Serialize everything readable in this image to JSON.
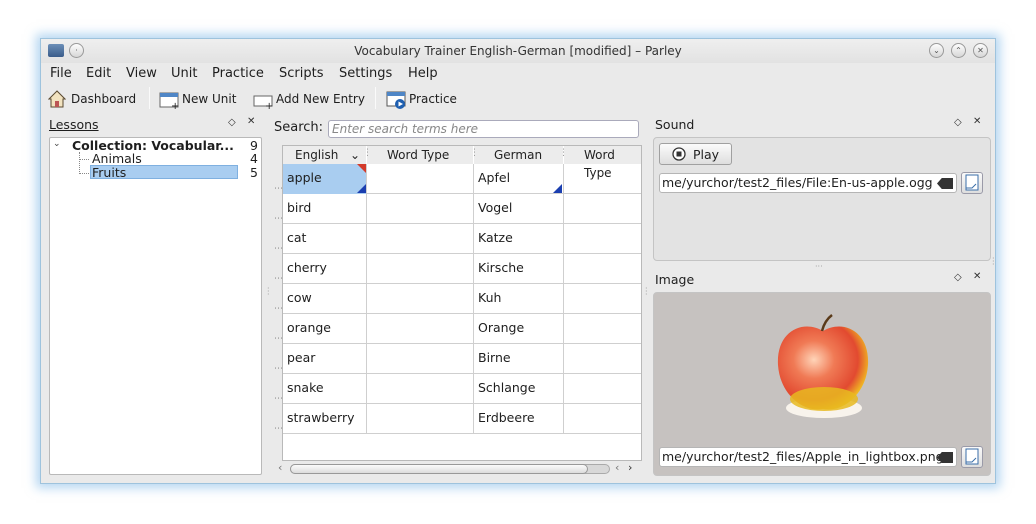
{
  "window": {
    "title": "Vocabulary Trainer English-German [modified] – Parley",
    "buttons": [
      "minimize-icon",
      "maximize-icon",
      "close-icon"
    ]
  },
  "menubar": [
    "File",
    "Edit",
    "View",
    "Unit",
    "Practice",
    "Scripts",
    "Settings",
    "Help"
  ],
  "toolbar": {
    "dashboard": "Dashboard",
    "new_unit": "New Unit",
    "add_entry": "Add New Entry",
    "practice": "Practice"
  },
  "lessons": {
    "title": "Lessons",
    "collection": {
      "name": "Collection: Vocabular...",
      "count": "9"
    },
    "units": [
      {
        "name": "Animals",
        "count": "4",
        "selected": false
      },
      {
        "name": "Fruits",
        "count": "5",
        "selected": true
      }
    ]
  },
  "search": {
    "label": "Search:",
    "placeholder": "Enter search terms here"
  },
  "table": {
    "columns": [
      "English",
      "Word Type",
      "German",
      "Word Type"
    ],
    "rows": [
      {
        "english": "apple",
        "type1": "",
        "german": "Apfel",
        "type2": ""
      },
      {
        "english": "bird",
        "type1": "",
        "german": "Vogel",
        "type2": ""
      },
      {
        "english": "cat",
        "type1": "",
        "german": "Katze",
        "type2": ""
      },
      {
        "english": "cherry",
        "type1": "",
        "german": "Kirsche",
        "type2": ""
      },
      {
        "english": "cow",
        "type1": "",
        "german": "Kuh",
        "type2": ""
      },
      {
        "english": "orange",
        "type1": "",
        "german": "Orange",
        "type2": ""
      },
      {
        "english": "pear",
        "type1": "",
        "german": "Birne",
        "type2": ""
      },
      {
        "english": "snake",
        "type1": "",
        "german": "Schlange",
        "type2": ""
      },
      {
        "english": "strawberry",
        "type1": "",
        "german": "Erdbeere",
        "type2": ""
      }
    ]
  },
  "sound": {
    "title": "Sound",
    "play": "Play",
    "file": "me/yurchor/test2_files/File:En-us-apple.ogg"
  },
  "image": {
    "title": "Image",
    "file": "me/yurchor/test2_files/Apple_in_lightbox.png"
  },
  "colors": {
    "selection": "#a9cdf0",
    "accent": "#3a78c8",
    "marker_red": "#d33a2a",
    "marker_blue": "#1b3fb0"
  }
}
